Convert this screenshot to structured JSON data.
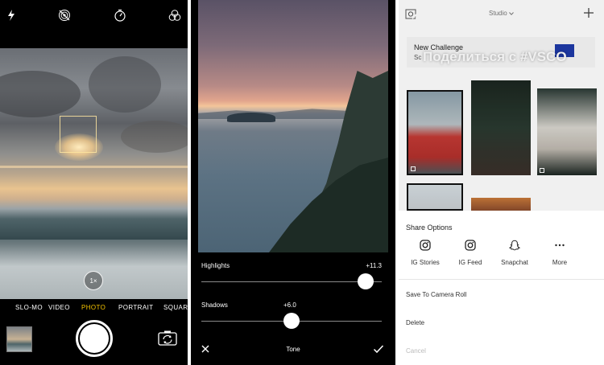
{
  "camera": {
    "zoom_label": "1×",
    "modes": [
      "SLO-MO",
      "VIDEO",
      "PHOTO",
      "PORTRAIT",
      "SQUARE"
    ],
    "active_mode": "PHOTO",
    "accent_color": "#f5c400"
  },
  "editor": {
    "highlights": {
      "label": "Highlights",
      "value": "+11.3",
      "level": 0.95
    },
    "shadows": {
      "label": "Shadows",
      "value": "+6.0",
      "level": 0.5
    },
    "tool_title": "Tone"
  },
  "vsco": {
    "header_title": "Studio",
    "challenge_title": "New Challenge",
    "challenge_sub": "Sc",
    "overlay_title": "Поделиться с #VSCO",
    "share_sheet_title": "Share Options",
    "share_options": [
      {
        "label": "IG Stories",
        "icon": "instagram-icon"
      },
      {
        "label": "IG Feed",
        "icon": "instagram-icon"
      },
      {
        "label": "Snapchat",
        "icon": "snapchat-icon"
      },
      {
        "label": "More",
        "icon": "more-dots-icon"
      }
    ],
    "actions": {
      "save": "Save To Camera Roll",
      "delete": "Delete",
      "cancel": "Cancel"
    }
  }
}
